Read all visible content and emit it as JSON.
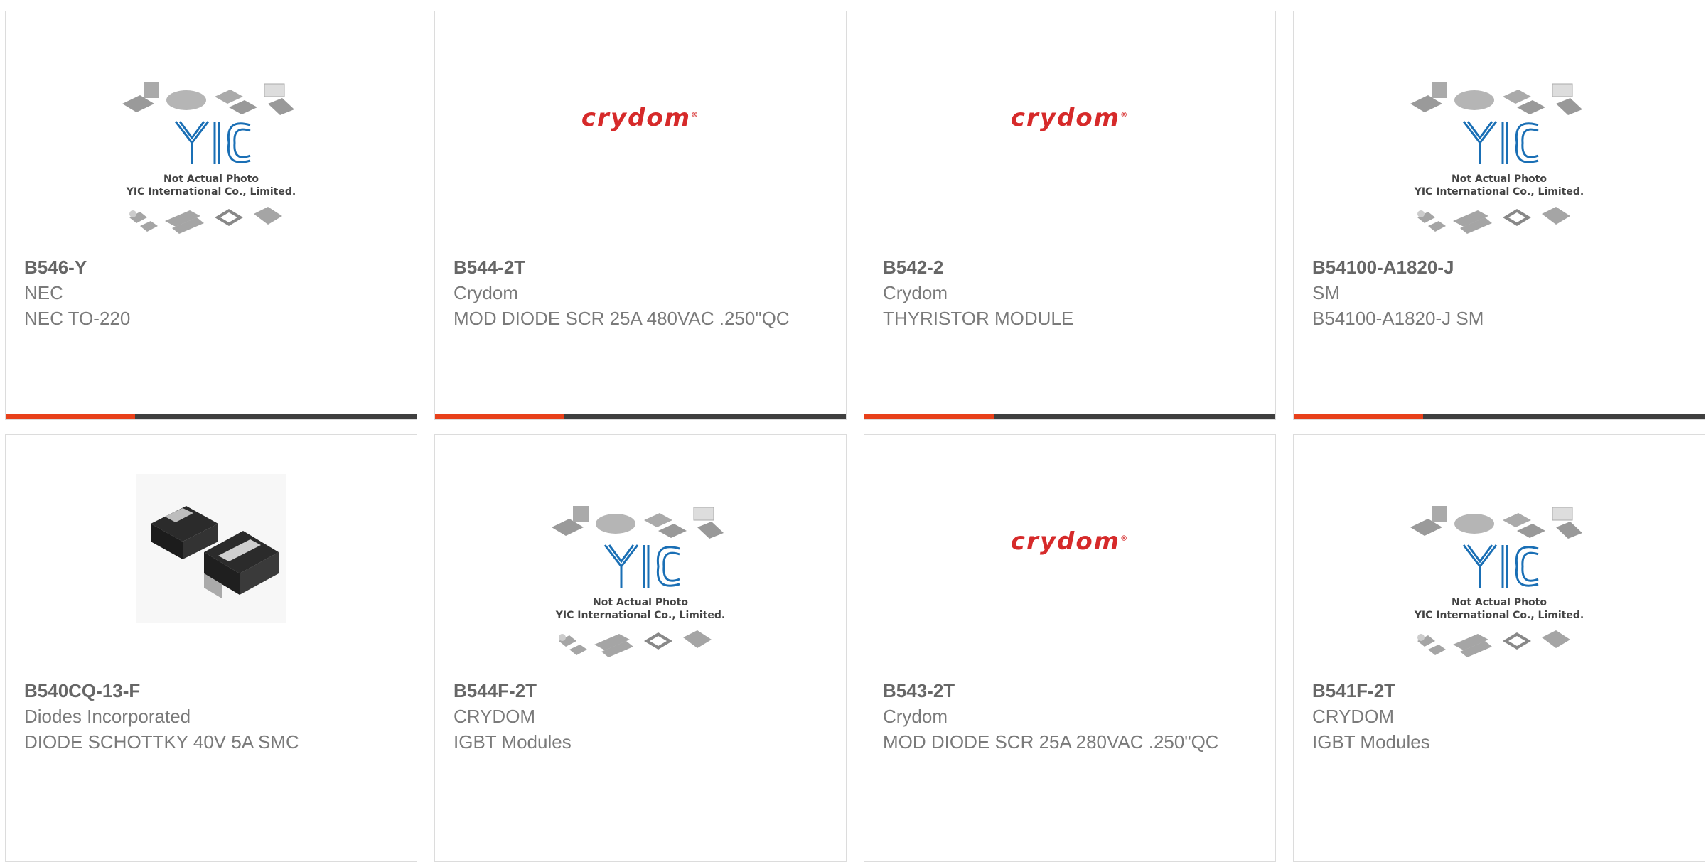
{
  "products": [
    {
      "part": "B546-Y",
      "maker": "NEC",
      "desc": "NEC TO-220",
      "image": "yic-placeholder"
    },
    {
      "part": "B544-2T",
      "maker": "Crydom",
      "desc": "MOD DIODE SCR 25A 480VAC .250\"QC",
      "image": "crydom-logo"
    },
    {
      "part": "B542-2",
      "maker": "Crydom",
      "desc": "THYRISTOR MODULE",
      "image": "crydom-logo"
    },
    {
      "part": "B54100-A1820-J",
      "maker": "SM",
      "desc": "B54100-A1820-J SM",
      "image": "yic-placeholder"
    },
    {
      "part": "B540CQ-13-F",
      "maker": "Diodes Incorporated",
      "desc": "DIODE SCHOTTKY 40V 5A SMC",
      "image": "smc-diode-photo"
    },
    {
      "part": "B544F-2T",
      "maker": "CRYDOM",
      "desc": "IGBT Modules",
      "image": "yic-placeholder"
    },
    {
      "part": "B543-2T",
      "maker": "Crydom",
      "desc": "MOD DIODE SCR 25A 280VAC .250\"QC",
      "image": "crydom-logo"
    },
    {
      "part": "B541F-2T",
      "maker": "CRYDOM",
      "desc": "IGBT Modules",
      "image": "yic-placeholder"
    }
  ],
  "placeholder": {
    "line1": "Not Actual Photo",
    "line2": "YIC International Co., Limited.",
    "brand": "YIC"
  },
  "crydom_logo_text": "crydom",
  "colors": {
    "accent": "#e8401a",
    "bar": "#3f3f3f",
    "crydom_red": "#d62a2a",
    "yic_blue": "#1a6fb5"
  }
}
